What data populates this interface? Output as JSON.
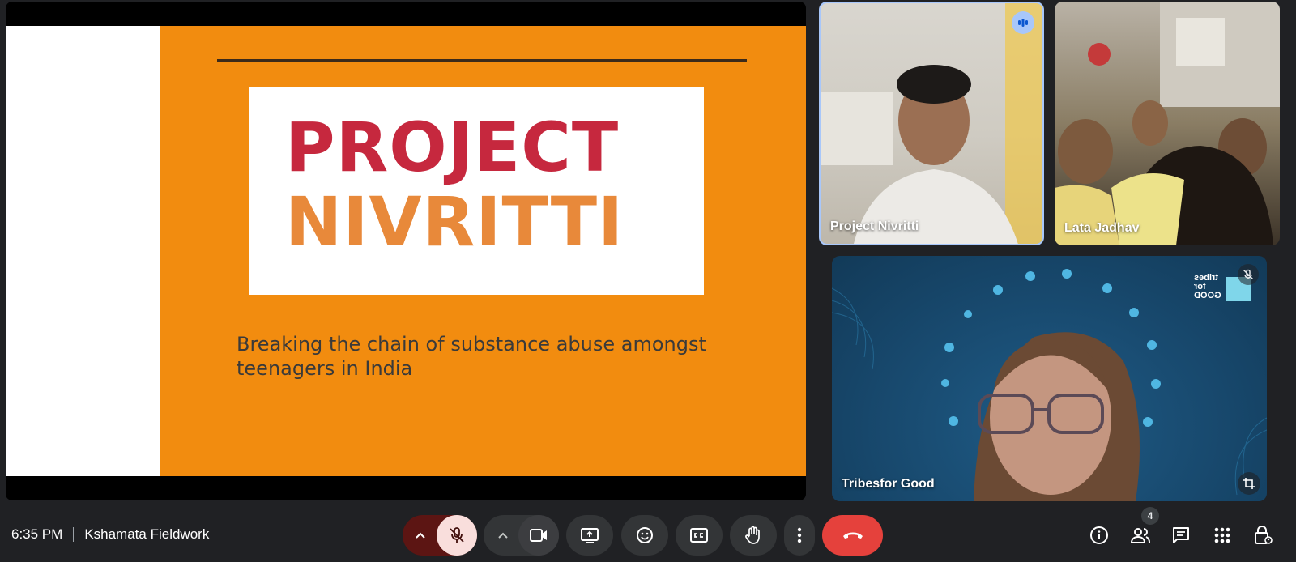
{
  "slide": {
    "title_line1": "PROJECT",
    "title_line2": "NIVRITTI",
    "subtitle": "Breaking the chain of substance abuse amongst teenagers in India"
  },
  "participants": [
    {
      "name": "Project Nivritti",
      "status": "speaking"
    },
    {
      "name": "Lata Jadhav",
      "status": "video"
    },
    {
      "name": "Tribesfor Good",
      "status": "muted",
      "logo_text": "tribes for GOOD"
    }
  ],
  "bottom_bar": {
    "time": "6:35 PM",
    "meeting_name": "Kshamata Fieldwork",
    "people_count": "4"
  },
  "colors": {
    "slide_orange": "#f28c0f",
    "title_red": "#c6283e",
    "title_orange": "#e8893a",
    "leave_red": "#e5413c",
    "speaking_blue": "#a8c7fa"
  }
}
